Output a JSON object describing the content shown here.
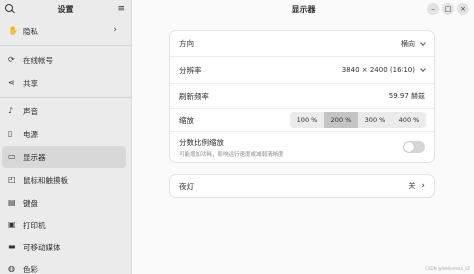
{
  "sidebar": {
    "title": "设置",
    "items": [
      {
        "label": "隐私",
        "icon": "✋"
      },
      {
        "label": "在线帐号",
        "icon": "⟳"
      },
      {
        "label": "共享",
        "icon": "⋖"
      },
      {
        "label": "声音",
        "icon": "♪"
      },
      {
        "label": "电源",
        "icon": "▯"
      },
      {
        "label": "显示器",
        "icon": "▭"
      },
      {
        "label": "鼠标和触摸板",
        "icon": "◰"
      },
      {
        "label": "键盘",
        "icon": "▤"
      },
      {
        "label": "打印机",
        "icon": "▣"
      },
      {
        "label": "可移动媒体",
        "icon": "▬"
      },
      {
        "label": "色彩",
        "icon": "◍"
      }
    ],
    "active_index": 5
  },
  "header": {
    "title": "显示器"
  },
  "display": {
    "orientation": {
      "label": "方向",
      "value": "横向"
    },
    "resolution": {
      "label": "分辨率",
      "value": "3840 × 2400 (16∶10)"
    },
    "refresh": {
      "label": "刷新频率",
      "value": "59.97 赫兹"
    },
    "scale": {
      "label": "缩放",
      "options": [
        "100 %",
        "200 %",
        "300 %",
        "400 %"
      ],
      "selected": "200 %"
    },
    "fractional": {
      "label": "分数比例缩放",
      "sublabel": "可能增加功耗，影响运行速度或减弱清晰度",
      "enabled": false
    }
  },
  "night_light": {
    "label": "夜灯",
    "value": "关"
  },
  "watermark": "CSDN @Wellerman_zZ"
}
